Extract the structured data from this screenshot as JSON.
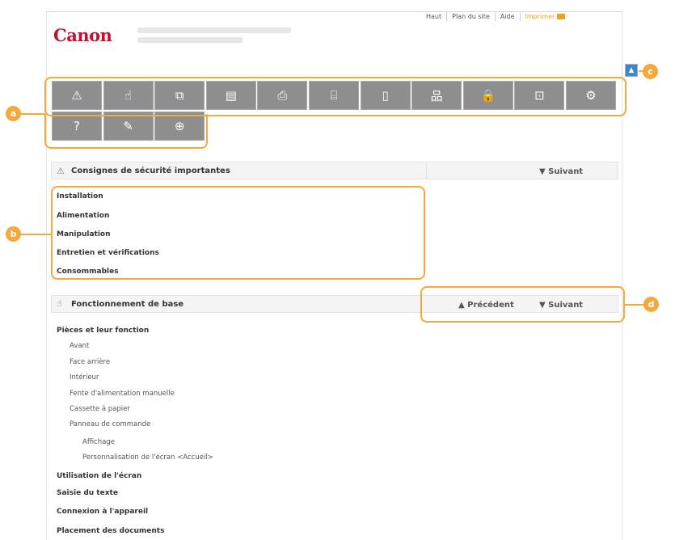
{
  "header": {
    "logo_text": "Canon",
    "links": [
      "Haut",
      "Plan du site",
      "Aide",
      "Imprimer"
    ]
  },
  "toolbar": {
    "icons": [
      "warning-icon",
      "hand-icon",
      "copy-icon",
      "fax-icon",
      "print-icon",
      "scan-icon",
      "mobile-icon",
      "network-icon",
      "lock-icon",
      "remote-icon",
      "settings-icon",
      "help-icon",
      "wrench-icon",
      "plus-icon"
    ],
    "glyphs": [
      "⚠",
      "☝",
      "⧉",
      "▤",
      "⎙",
      "⌸",
      "▯",
      "品",
      "🔒",
      "⊡",
      "⚙",
      "?",
      "✎",
      "⊕"
    ]
  },
  "callouts": {
    "a": "a",
    "b": "b",
    "c": "c",
    "d": "d"
  },
  "sections": [
    {
      "title": "Consignes de sécurité importantes",
      "next": "▼ Suivant",
      "items": [
        "Installation",
        "Alimentation",
        "Manipulation",
        "Entretien et vérifications",
        "Consommables"
      ]
    },
    {
      "title": "Fonctionnement de base",
      "prev": "▲ Précédent",
      "next": "▼ Suivant",
      "items": [
        {
          "text": "Pièces et leur fonction",
          "level": 0
        },
        {
          "text": "Avant",
          "level": 1
        },
        {
          "text": "Face arrière",
          "level": 1
        },
        {
          "text": "Intérieur",
          "level": 1
        },
        {
          "text": "Fente d'alimentation manuelle",
          "level": 1
        },
        {
          "text": "Cassette à papier",
          "level": 1
        },
        {
          "text": "Panneau de commande",
          "level": 1
        },
        {
          "text": "Affichage",
          "level": 2
        },
        {
          "text": "Personnalisation de l'écran <Accueil>",
          "level": 2
        },
        {
          "text": "Utilisation de l'écran",
          "level": 0
        },
        {
          "text": "Saisie du texte",
          "level": 0
        },
        {
          "text": "Connexion à l'appareil",
          "level": 0
        },
        {
          "text": "Placement des documents",
          "level": 0
        }
      ]
    }
  ]
}
